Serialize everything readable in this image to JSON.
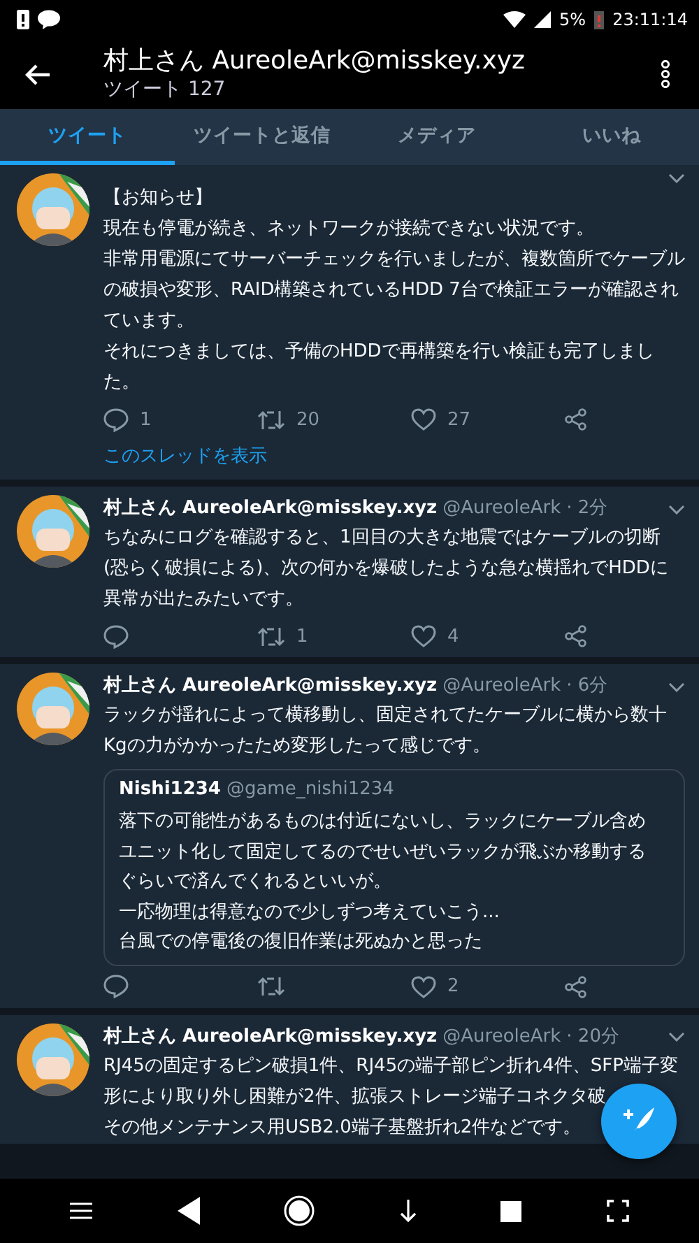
{
  "status_bar": {
    "battery_percent": "5%",
    "time": "23:11:14"
  },
  "header": {
    "title": "村上さん AureoleArk@misskey.xyz",
    "subtitle": "ツイート 127"
  },
  "tabs": [
    {
      "label": "ツイート",
      "selected": true
    },
    {
      "label": "ツイートと返信",
      "selected": false
    },
    {
      "label": "メディア",
      "selected": false
    },
    {
      "label": "いいね",
      "selected": false
    }
  ],
  "tweets": [
    {
      "paragraphs": [
        "【お知らせ】",
        "現在も停電が続き、ネットワークが接続できない状況です。",
        "非常用電源にてサーバーチェックを行いましたが、複数箇所でケーブルの破損や変形、RAID構築されているHDD 7台で検証エラーが確認されています。",
        "それにつきましては、予備のHDDで再構築を行い検証も完了しました。"
      ],
      "replies": "1",
      "retweets": "20",
      "likes": "27",
      "thread_link": "このスレッドを表示"
    },
    {
      "name": "村上さん AureoleArk@misskey.xyz",
      "handle": "@AureoleArk",
      "time": "· 2分",
      "paragraphs": [
        "ちなみにログを確認すると、1回目の大きな地震ではケーブルの切断(恐らく破損による)、次の何かを爆破したような急な横揺れでHDDに異常が出たみたいです。"
      ],
      "retweets": "1",
      "likes": "4"
    },
    {
      "name": "村上さん AureoleArk@misskey.xyz",
      "handle": "@AureoleArk",
      "time": "· 6分",
      "paragraphs": [
        "ラックが揺れによって横移動し、固定されてたケーブルに横から数十Kgの力がかかったため変形したって感じです。"
      ],
      "quote": {
        "name": "Nishi1234",
        "handle": "@game_nishi1234",
        "paragraphs": [
          "落下の可能性があるものは付近にないし、ラックにケーブル含めユニット化して固定してるのでせいぜいラックが飛ぶか移動するぐらいで済んでくれるといいが。",
          "一応物理は得意なので少しずつ考えていこう...",
          "台風での停電後の復旧作業は死ぬかと思った"
        ]
      },
      "likes": "2"
    },
    {
      "name": "村上さん AureoleArk@misskey.xyz",
      "handle": "@AureoleArk",
      "time": "· 20分",
      "paragraphs": [
        "RJ45の固定するピン破損1件、RJ45の端子部ピン折れ4件、SFP端子変",
        "形により取り外し困難が2件、拡張ストレージ端子コネクタ破",
        "その他メンテナンス用USB2.0端子基盤折れ2件などです。"
      ]
    }
  ]
}
